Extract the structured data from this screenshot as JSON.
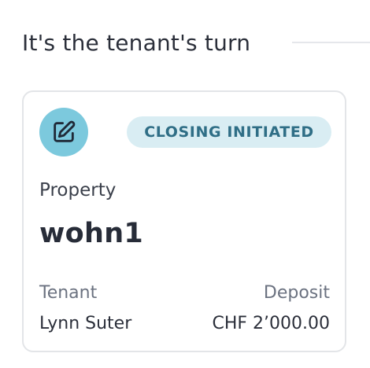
{
  "section": {
    "title": "It's the tenant's turn"
  },
  "card": {
    "icon": "edit-square-icon",
    "status": "CLOSING INITIATED",
    "property_label": "Property",
    "property_name": "wohn1",
    "tenant_label": "Tenant",
    "tenant_name": "Lynn Suter",
    "deposit_label": "Deposit",
    "deposit_value": "CHF 2’000.00"
  },
  "colors": {
    "icon_circle": "#7cc9dd",
    "badge_bg": "#d9edf3",
    "badge_text": "#2f6e86",
    "card_border": "#e3e5e8"
  }
}
